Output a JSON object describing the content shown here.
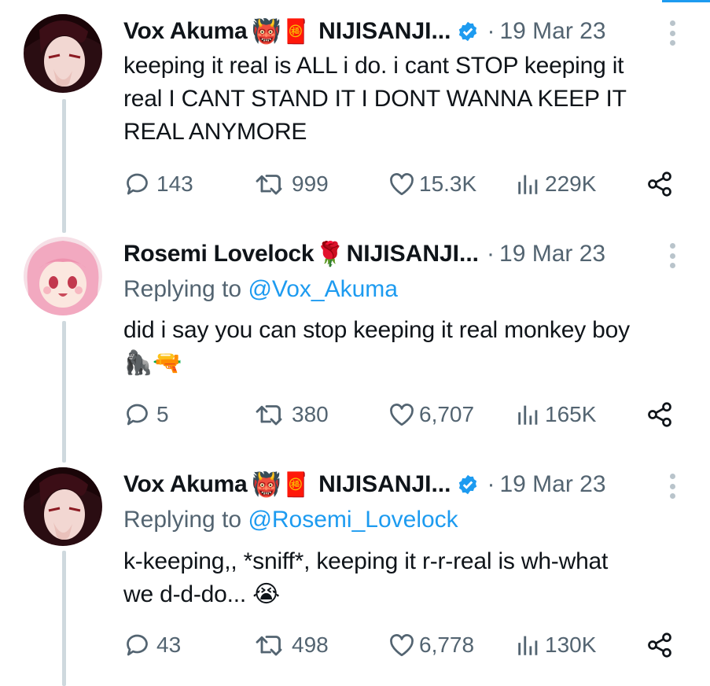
{
  "tweets": [
    {
      "name": "Vox Akuma",
      "name_emoji": "👹🧧",
      "affiliation": "NIJISANJI...",
      "verified": true,
      "separator": "·",
      "date": "19 Mar 23",
      "replying_to_label": "",
      "replying_to_handle": "",
      "text_lines": [
        "keeping it real is ALL i do. i cant STOP keeping it",
        "real I CANT STAND IT I DONT WANNA KEEP IT",
        "REAL ANYMORE"
      ],
      "replies": "143",
      "retweets": "999",
      "likes": "15.3K",
      "views": "229K"
    },
    {
      "name": "Rosemi Lovelock",
      "name_emoji": "🌹",
      "affiliation": "NIJISANJI...",
      "verified": false,
      "separator": "·",
      "date": "19 Mar 23",
      "replying_to_label": "Replying to",
      "replying_to_handle": "@Vox_Akuma",
      "text_lines": [
        "did i say you can stop keeping it real monkey boy",
        "🦍🔫"
      ],
      "replies": "5",
      "retweets": "380",
      "likes": "6,707",
      "views": "165K"
    },
    {
      "name": "Vox Akuma",
      "name_emoji": "👹🧧",
      "affiliation": "NIJISANJI...",
      "verified": true,
      "separator": "·",
      "date": "19 Mar 23",
      "replying_to_label": "Replying to",
      "replying_to_handle": "@Rosemi_Lovelock",
      "text_lines": [
        "k-keeping,, *sniff*, keeping it r-r-real is wh-what",
        "we d-d-do... 😭"
      ],
      "replies": "43",
      "retweets": "498",
      "likes": "6,778",
      "views": "130K"
    }
  ],
  "colors": {
    "link": "#1d9bf0",
    "secondary_text": "#536471",
    "thread_line": "#cfd9de",
    "verified": "#1d9bf0"
  },
  "icons": [
    "reply-icon",
    "retweet-icon",
    "like-icon",
    "views-icon",
    "share-icon",
    "verified-badge-icon",
    "more-options-icon"
  ]
}
